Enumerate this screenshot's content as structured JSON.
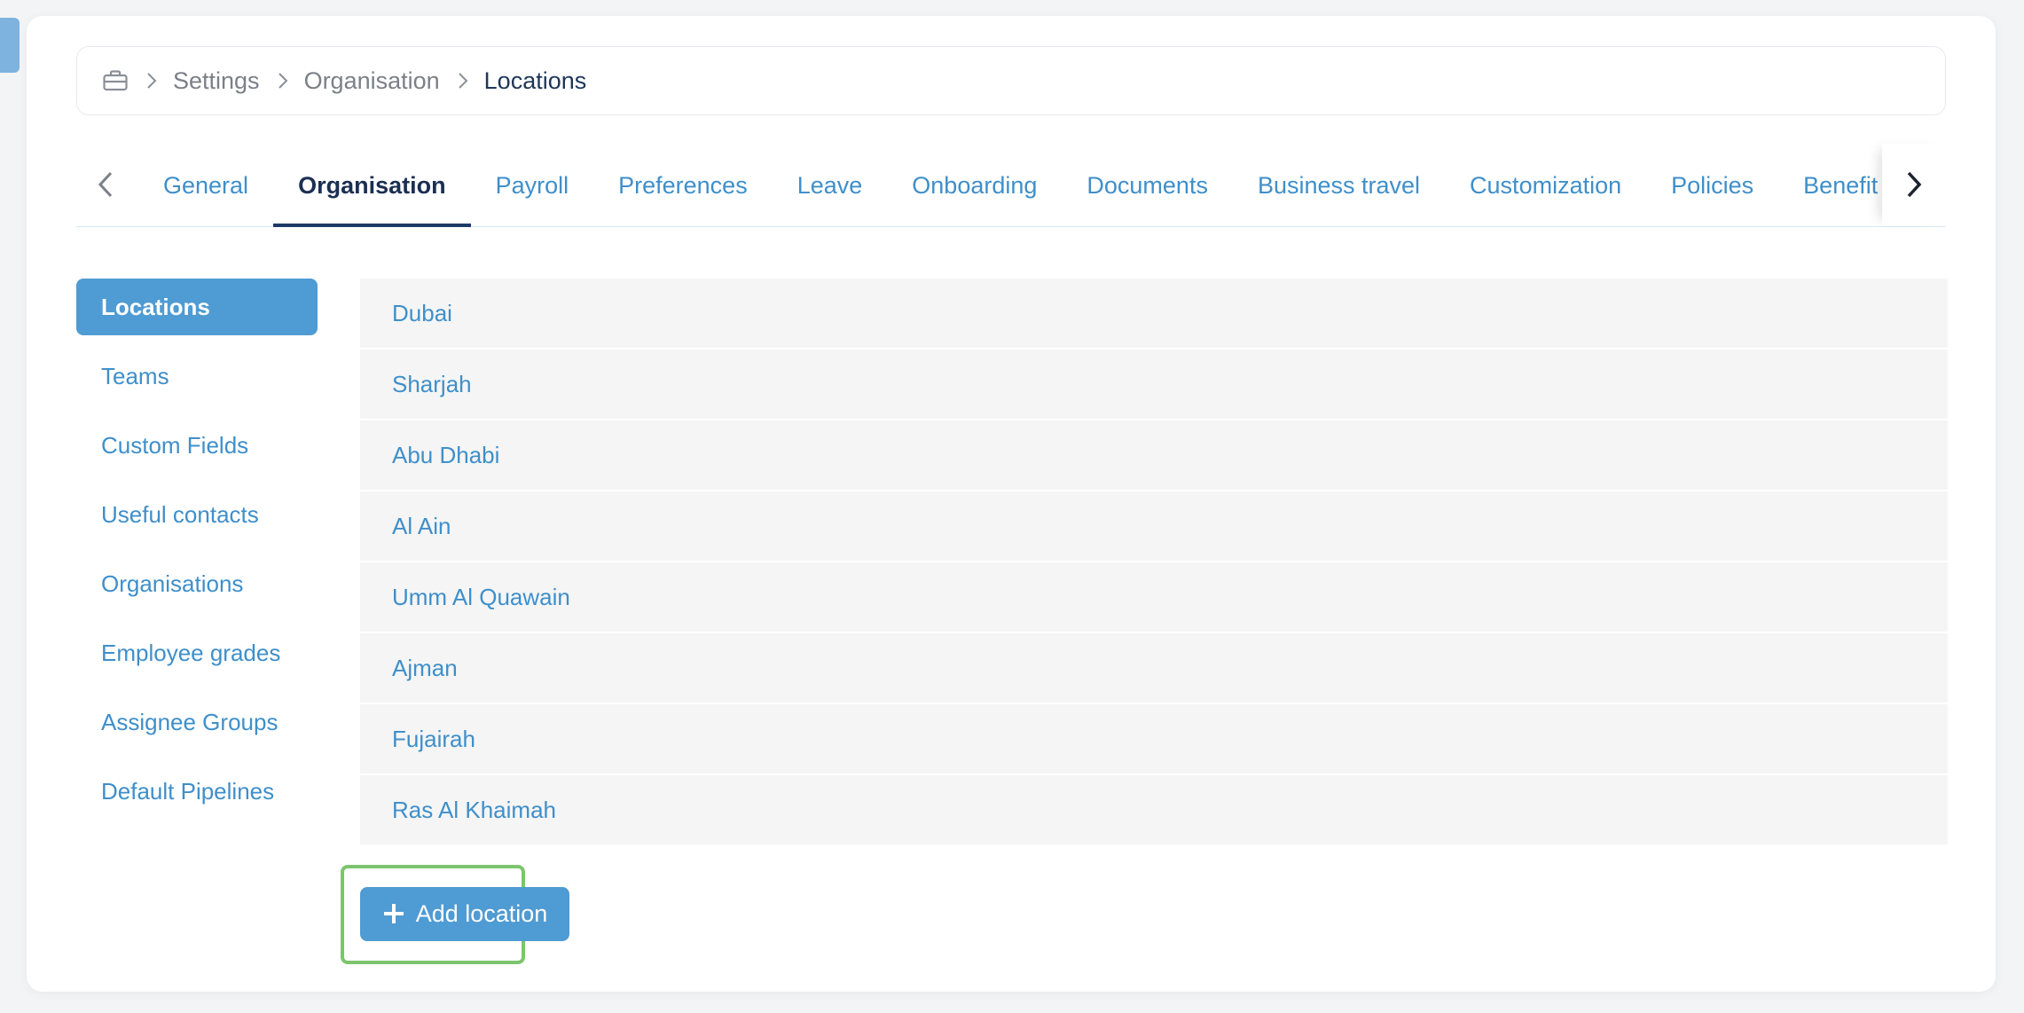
{
  "breadcrumb": {
    "icon": "briefcase-icon",
    "items": [
      "Settings",
      "Organisation"
    ],
    "current": "Locations"
  },
  "tabs": {
    "items": [
      "General",
      "Organisation",
      "Payroll",
      "Preferences",
      "Leave",
      "Onboarding",
      "Documents",
      "Business travel",
      "Customization",
      "Policies",
      "Benefit"
    ],
    "active": "Organisation"
  },
  "side_nav": {
    "items": [
      "Locations",
      "Teams",
      "Custom Fields",
      "Useful contacts",
      "Organisations",
      "Employee grades",
      "Assignee Groups",
      "Default Pipelines"
    ],
    "active": "Locations"
  },
  "locations": [
    "Dubai",
    "Sharjah",
    "Abu Dhabi",
    "Al Ain",
    "Umm Al Quawain",
    "Ajman",
    "Fujairah",
    "Ras Al Khaimah"
  ],
  "add_button": {
    "icon": "plus-icon",
    "label": "Add location"
  },
  "colors": {
    "accent": "#4f9bd3",
    "link": "#3f8fca",
    "dark": "#1b2f52",
    "highlight": "#7cc56d"
  }
}
